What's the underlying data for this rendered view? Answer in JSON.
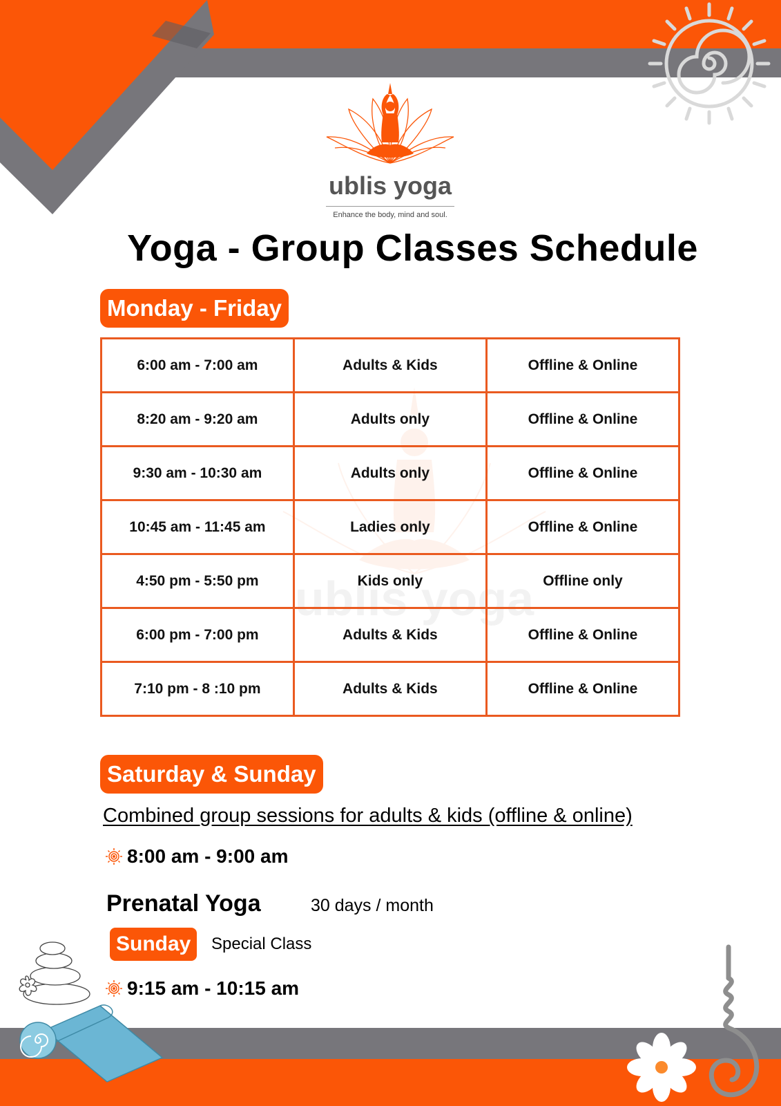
{
  "brand": {
    "name": "ublis yoga",
    "tagline": "Enhance the body, mind and soul."
  },
  "title": "Yoga - Group Classes Schedule",
  "weekday": {
    "label": "Monday - Friday",
    "rows": [
      {
        "time": "6:00 am - 7:00 am",
        "group": "Adults & Kids",
        "mode": "Offline & Online"
      },
      {
        "time": "8:20 am - 9:20 am",
        "group": "Adults only",
        "mode": "Offline & Online"
      },
      {
        "time": "9:30 am - 10:30 am",
        "group": "Adults only",
        "mode": "Offline & Online"
      },
      {
        "time": "10:45 am - 11:45 am",
        "group": "Ladies only",
        "mode": "Offline & Online"
      },
      {
        "time": "4:50 pm - 5:50 pm",
        "group": "Kids only",
        "mode": "Offline only"
      },
      {
        "time": "6:00 pm - 7:00 pm",
        "group": "Adults & Kids",
        "mode": "Offline & Online"
      },
      {
        "time": "7:10 pm - 8 :10 pm",
        "group": "Adults & Kids",
        "mode": "Offline & Online"
      }
    ]
  },
  "weekend": {
    "label": "Saturday & Sunday",
    "description": "Combined group sessions for adults & kids (offline & online)",
    "time": "8:00 am - 9:00 am"
  },
  "prenatal": {
    "title": "Prenatal Yoga",
    "frequency": "30 days / month",
    "day_label": "Sunday",
    "note": "Special Class",
    "time": "9:15 am - 10:15 am"
  },
  "colors": {
    "accent": "#fb5607",
    "band_gray": "#77767b",
    "table_border": "#ea5a20",
    "mat_blue": "#6bb6d4"
  },
  "icons": [
    "lotus-meditation-logo",
    "sun-spiral-icon",
    "sun-bullet-icon",
    "stacked-stones-icon",
    "yoga-mat-icon",
    "daisy-flower-icon",
    "incense-spiral-icon"
  ]
}
